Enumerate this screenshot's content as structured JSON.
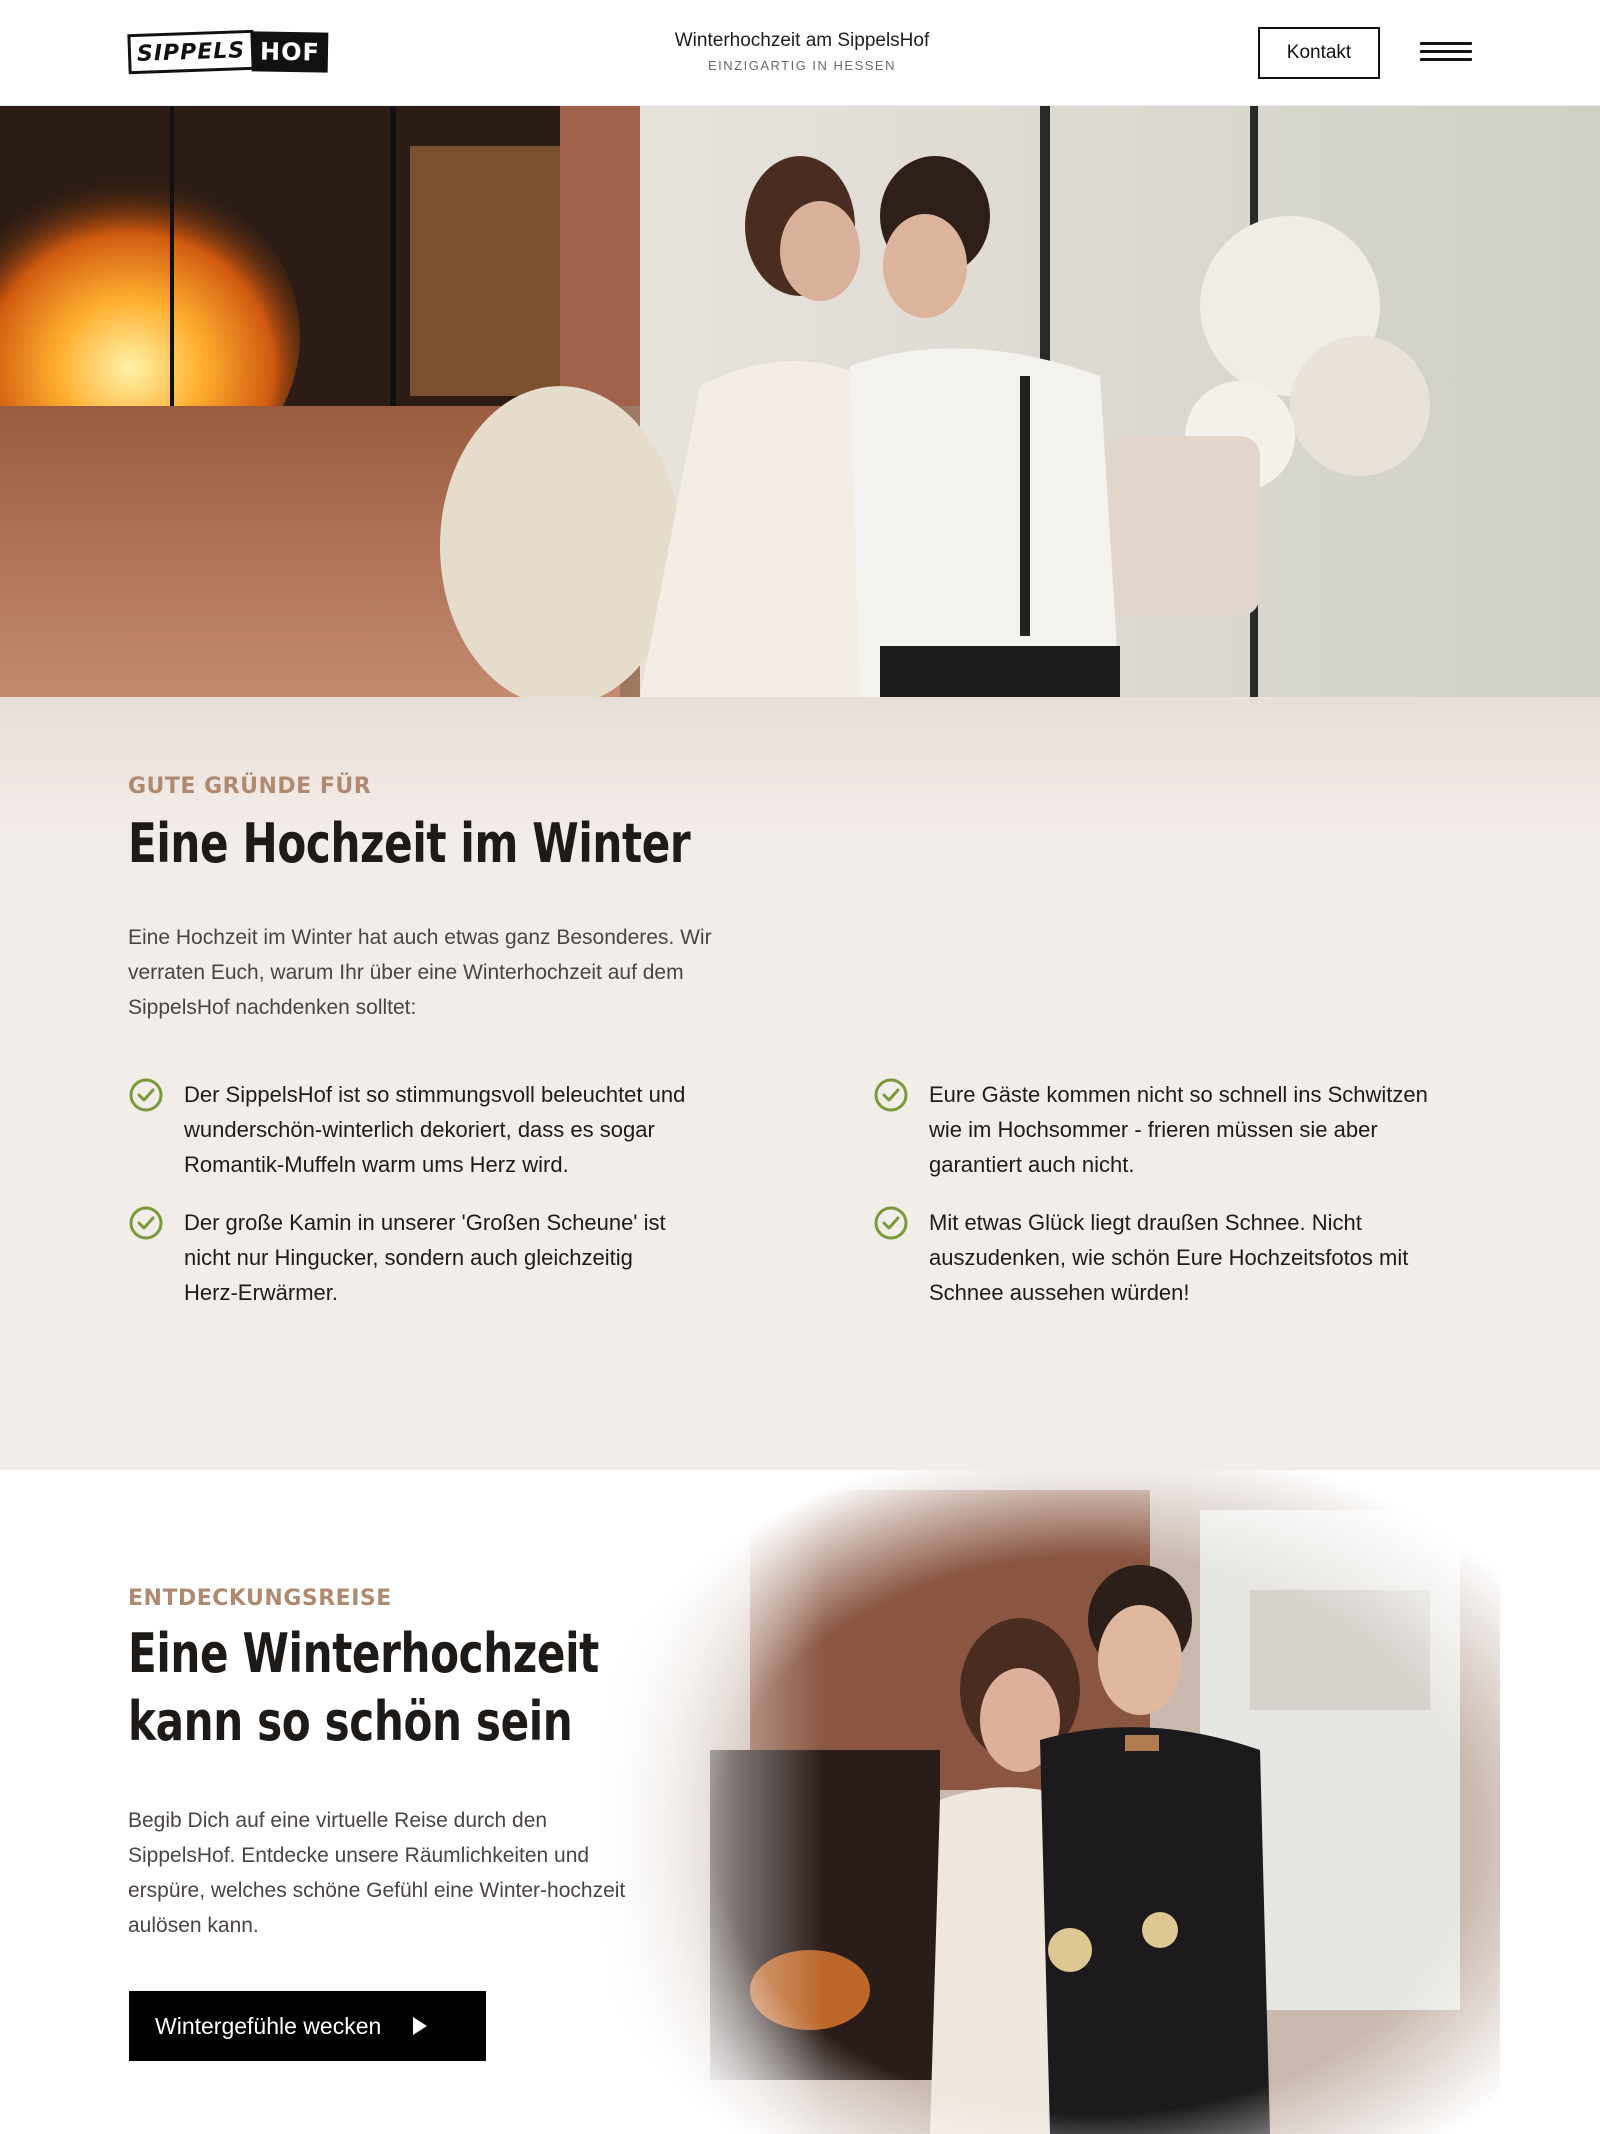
{
  "header": {
    "logo_left": "SIPPELS",
    "logo_right": "HOF",
    "title": "Winterhochzeit am SippelsHof",
    "subtitle": "EINZIGARTIG IN HESSEN",
    "contact_label": "Kontakt",
    "menu_icon": "hamburger-menu-icon"
  },
  "hero": {
    "image": "photo-couple-kissing-by-fireplace"
  },
  "reasons": {
    "eyebrow": "GUTE GRÜNDE FÜR",
    "headline": "Eine Hochzeit im Winter",
    "intro": "Eine Hochzeit im Winter hat auch etwas ganz Besonderes. Wir verraten Euch, warum Ihr über eine Winterhochzeit auf dem SippelsHof nachdenken solltet:",
    "items": [
      {
        "text": "Der SippelsHof ist so stimmungsvoll beleuchtet und wunderschön-winterlich dekoriert, dass es sogar Romantik-Muffeln warm ums Herz wird."
      },
      {
        "text": "Der große Kamin in unserer 'Großen Scheune' ist nicht nur Hingucker, sondern auch gleichzeitig Herz-Erwärmer."
      },
      {
        "text": "Eure Gäste kommen nicht so schnell ins Schwitzen wie im Hochsommer - frieren müssen sie aber garantiert auch nicht."
      },
      {
        "text": "Mit etwas Glück liegt draußen Schnee. Nicht auszudenken, wie schön Eure Hochzeitsfotos mit Schnee aussehen würden!"
      }
    ],
    "check_icon_color": "#7a9a3a"
  },
  "discovery": {
    "eyebrow": "ENTDECKUNGSREISE",
    "headline_line1": "Eine Winterhochzeit",
    "headline_line2": "kann so schön sein",
    "text": "Begib Dich auf eine virtuelle Reise durch den SippelsHof. Entdecke unsere Räumlichkeiten und erspüre, welches schöne Gefühl eine Winter-hochzeit aulösen kann.",
    "cta_label": "Wintergefühle wecken",
    "image": "photo-couple-with-sparklers"
  },
  "colors": {
    "accent": "#b08a70",
    "section_bg": "#f3edea",
    "button_bg": "#000000"
  }
}
